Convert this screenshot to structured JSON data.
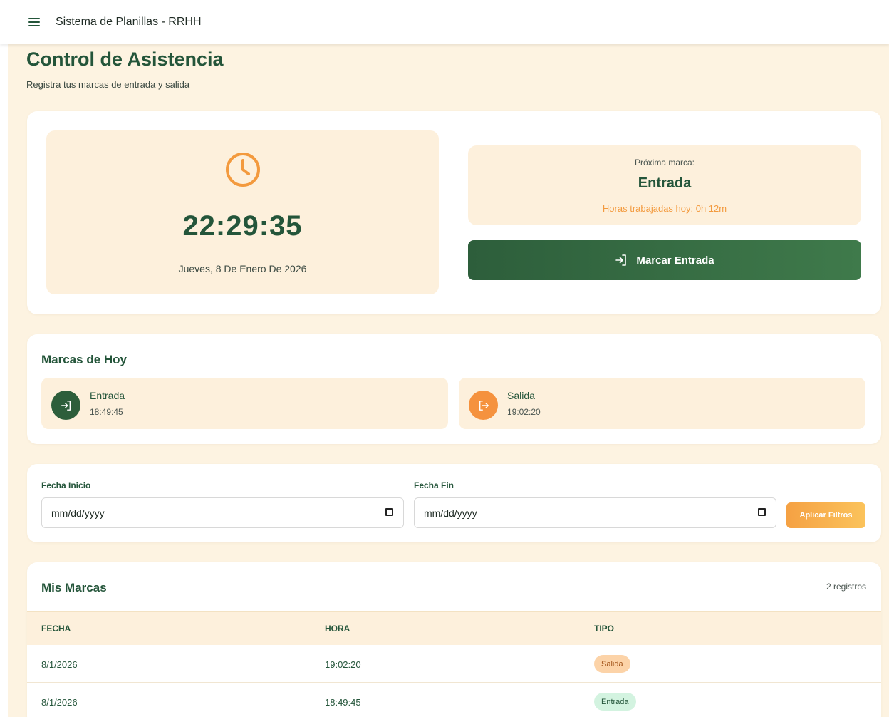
{
  "header": {
    "app_title": "Sistema de Planillas - RRHH"
  },
  "page": {
    "title": "Control de Asistencia",
    "subtitle": "Registra tus marcas de entrada y salida"
  },
  "clock": {
    "time": "22:29:35",
    "date": "Jueves, 8 De Enero De 2026",
    "icon": "clock-icon"
  },
  "next_mark": {
    "label": "Próxima marca:",
    "value": "Entrada",
    "hours_worked": "Horas trabajadas hoy: 0h 12m"
  },
  "mark_button": {
    "label": "Marcar Entrada",
    "icon": "login-icon"
  },
  "today": {
    "title": "Marcas de Hoy",
    "items": [
      {
        "type": "Entrada",
        "time": "18:49:45",
        "icon": "login-icon",
        "color": "#2d5e3b"
      },
      {
        "type": "Salida",
        "time": "19:02:20",
        "icon": "logout-icon",
        "color": "#f5923e"
      }
    ]
  },
  "filters": {
    "start_label": "Fecha Inicio",
    "start_placeholder": "mm/dd/yyyy",
    "end_label": "Fecha Fin",
    "end_placeholder": "mm/dd/yyyy",
    "apply_label": "Aplicar Filtros"
  },
  "table": {
    "title": "Mis Marcas",
    "count": "2 registros",
    "headers": [
      "FECHA",
      "HORA",
      "TIPO"
    ],
    "rows": [
      {
        "fecha": "8/1/2026",
        "hora": "19:02:20",
        "tipo": "Salida"
      },
      {
        "fecha": "8/1/2026",
        "hora": "18:49:45",
        "tipo": "Entrada"
      }
    ]
  },
  "colors": {
    "primary_green": "#24553a",
    "accent_orange": "#f39a3e",
    "background": "#fdf3e1",
    "panel": "#fdf0dc",
    "badge_salida_bg": "#fcd3a8",
    "badge_entrada_bg": "#d3f3e0"
  }
}
